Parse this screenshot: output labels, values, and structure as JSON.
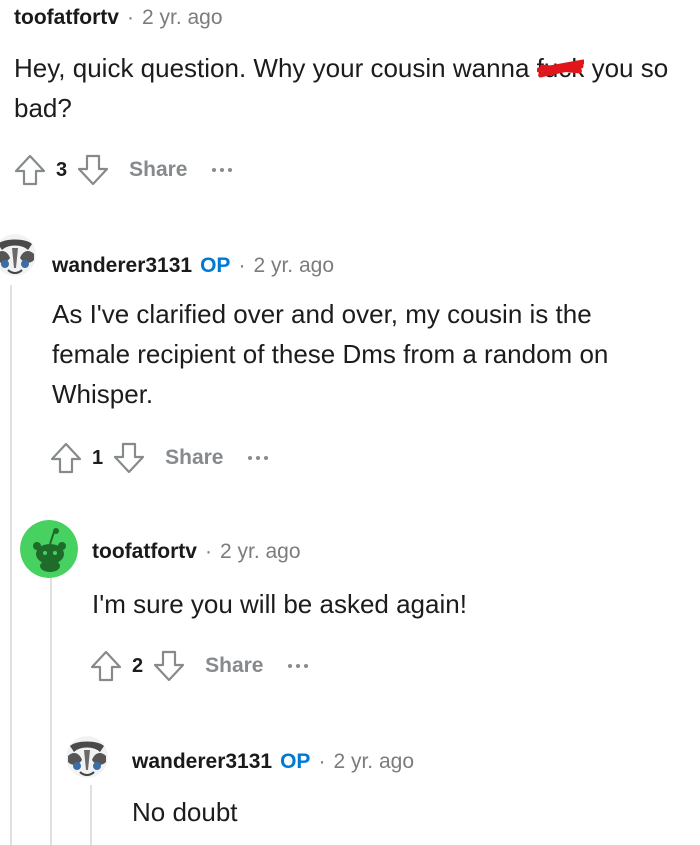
{
  "comments": [
    {
      "author": "toofatfortv",
      "op_badge": "",
      "separator": "·",
      "time": "2 yr. ago",
      "body_before": "Hey, quick question. Why your cousin wanna ",
      "body_censored": "fuck",
      "body_after": " you so bad?",
      "votes": "3",
      "share_label": "Share",
      "avatar_icon": "none"
    },
    {
      "author": "wanderer3131",
      "op_badge": "OP",
      "separator": "·",
      "time": "2 yr. ago",
      "body": "As I've clarified over and over, my cousin is the female recipient of these Dms from a random on Whisper.",
      "votes": "1",
      "share_label": "Share",
      "avatar_icon": "custom-avatar-icon"
    },
    {
      "author": "toofatfortv",
      "op_badge": "",
      "separator": "·",
      "time": "2 yr. ago",
      "body": "I'm sure you will be asked again!",
      "votes": "2",
      "share_label": "Share",
      "avatar_icon": "snoo-avatar-icon"
    },
    {
      "author": "wanderer3131",
      "op_badge": "OP",
      "separator": "·",
      "time": "2 yr. ago",
      "body": "No doubt",
      "avatar_icon": "custom-avatar-icon"
    }
  ],
  "colors": {
    "op": "#0079d3",
    "meta": "#7c7c7c",
    "text": "#1c1c1c",
    "action": "#878a8c",
    "snoo_bg": "#46d160",
    "censor": "#e0161b"
  }
}
